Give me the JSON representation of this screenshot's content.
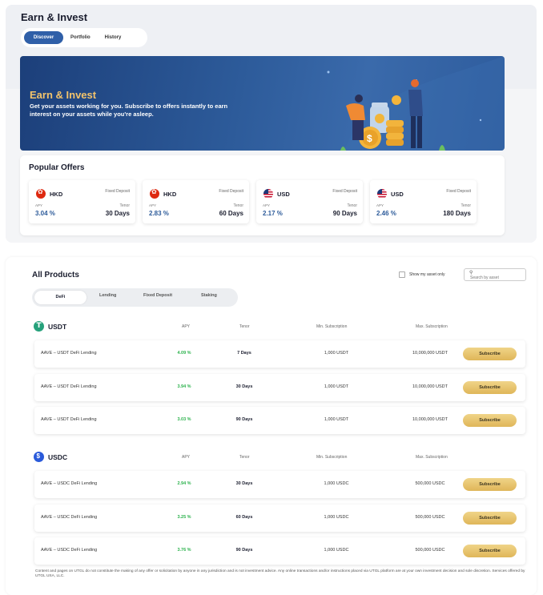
{
  "header": {
    "title": "Earn & Invest",
    "tabs": [
      "Discover",
      "Portfolio",
      "History"
    ]
  },
  "banner": {
    "title": "Earn & Invest",
    "subtitle": "Get your assets working for you. Subscribe to offers instantly to earn interest on your assets while you're asleep."
  },
  "popular_offers": {
    "title": "Popular Offers",
    "apy_label": "APY",
    "tenor_label": "Tenor",
    "items": [
      {
        "currency": "HKD",
        "type": "Fixed Deposit",
        "apy": "3.04 %",
        "tenor": "30 Days",
        "flag": "hk-flag-icon"
      },
      {
        "currency": "HKD",
        "type": "Fixed Deposit",
        "apy": "2.83 %",
        "tenor": "60 Days",
        "flag": "hk-flag-icon"
      },
      {
        "currency": "USD",
        "type": "Fixed Deposit",
        "apy": "2.17 %",
        "tenor": "90 Days",
        "flag": "us-flag-icon"
      },
      {
        "currency": "USD",
        "type": "Fixed Deposit",
        "apy": "2.46 %",
        "tenor": "180 Days",
        "flag": "us-flag-icon"
      }
    ]
  },
  "all_products": {
    "title": "All Products",
    "show_my_asset_only": "Show my asset only",
    "search_placeholder": "Search by asset",
    "tabs": [
      "DeFi",
      "Lending",
      "Fixed Deposit",
      "Staking"
    ],
    "columns": {
      "apy": "APY",
      "tenor": "Tenor",
      "min": "Min. Subscription",
      "max": "Max. Subscription"
    },
    "subscribe_label": "Subscribe",
    "sections": [
      {
        "asset": "USDT",
        "rows": [
          {
            "product": "AAVE – USDT DeFi Lending",
            "apy": "4.09 %",
            "tenor": "7 Days",
            "min": "1,000 USDT",
            "max": "10,000,000 USDT"
          },
          {
            "product": "AAVE – USDT DeFi Lending",
            "apy": "3.94 %",
            "tenor": "30 Days",
            "min": "1,000 USDT",
            "max": "10,000,000 USDT"
          },
          {
            "product": "AAVE – USDT DeFi Lending",
            "apy": "3.03 %",
            "tenor": "90 Days",
            "min": "1,000 USDT",
            "max": "10,000,000 USDT"
          }
        ]
      },
      {
        "asset": "USDC",
        "rows": [
          {
            "product": "AAVE – USDC DeFi Lending",
            "apy": "2.94 %",
            "tenor": "30 Days",
            "min": "1,000 USDC",
            "max": "500,000 USDC"
          },
          {
            "product": "AAVE – USDC DeFi Lending",
            "apy": "3.25 %",
            "tenor": "60 Days",
            "min": "1,000 USDC",
            "max": "500,000 USDC"
          },
          {
            "product": "AAVE – USDC DeFi Lending",
            "apy": "3.76 %",
            "tenor": "90 Days",
            "min": "1,000 USDC",
            "max": "500,000 USDC"
          }
        ]
      }
    ],
    "disclaimer": "Content and pages on UTGL do not constitute the making of any offer or solicitation by anyone in any jurisdiction and is not investment advice.  Any online transactions and/or instructions placed via UTGL platform are at your own investment decision and sole discretion. Services offered by UTGL USA, LLC."
  },
  "colors": {
    "accent_blue": "#2f5fa8",
    "apy_green": "#2bb24c",
    "subscribe_gold": "#e3bd62",
    "banner_title_gold": "#f2c36b"
  }
}
